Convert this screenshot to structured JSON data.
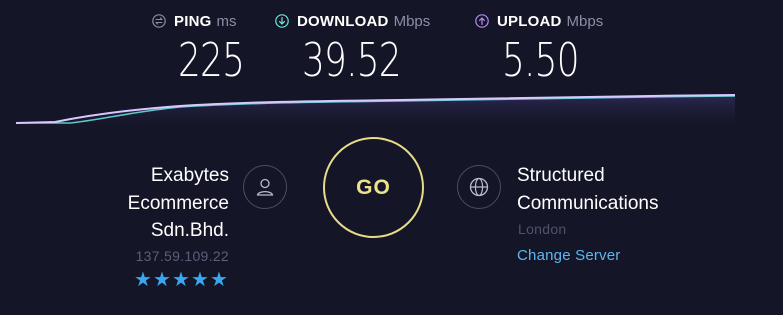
{
  "metrics": {
    "ping": {
      "label": "PING",
      "unit": "ms",
      "value": "225",
      "icon": "ping-icon",
      "color": "#8b8fa6"
    },
    "download": {
      "label": "DOWNLOAD",
      "unit": "Mbps",
      "value": "39.52",
      "icon": "download-arrow-icon",
      "color": "#6ce6e0"
    },
    "upload": {
      "label": "UPLOAD",
      "unit": "Mbps",
      "value": "5.50",
      "icon": "upload-arrow-icon",
      "color": "#b98bf2"
    }
  },
  "isp": {
    "name_lines": [
      "Exabytes",
      "Ecommerce",
      "Sdn.Bhd."
    ],
    "ip": "137.59.109.22",
    "rating": 5,
    "rating_max": 5,
    "icon": "user-icon"
  },
  "go": {
    "label": "GO"
  },
  "server": {
    "name_lines": [
      "Structured",
      "Communications"
    ],
    "location": "London",
    "change_label": "Change Server",
    "icon": "globe-icon"
  },
  "colors": {
    "background": "#141526",
    "go_ring": "#e6dc89",
    "link": "#5bb8f3",
    "star": "#3aa6ee"
  }
}
